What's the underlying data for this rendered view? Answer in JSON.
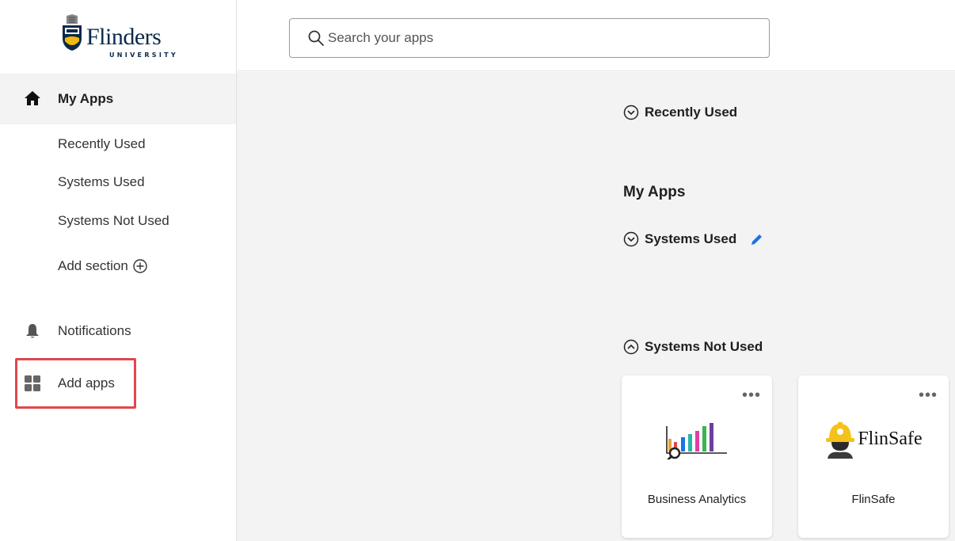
{
  "logo": {
    "wordmark": "Flinders",
    "subtitle": "UNIVERSITY"
  },
  "sidebar": {
    "home_label": "My Apps",
    "sub_items": [
      "Recently Used",
      "Systems Used",
      "Systems Not Used"
    ],
    "add_section_label": "Add section",
    "notifications_label": "Notifications",
    "add_apps_label": "Add apps"
  },
  "search": {
    "placeholder": "Search your apps",
    "value": ""
  },
  "main": {
    "recently_used": "Recently Used",
    "heading": "My Apps",
    "systems_used": "Systems Used",
    "systems_not_used": "Systems Not Used",
    "cards": [
      {
        "name": "Business Analytics",
        "icon": "bar-chart-magnifier-icon"
      },
      {
        "name": "FlinSafe",
        "icon": "hard-hat-worker-icon",
        "logo_text": "FlinSafe"
      }
    ]
  },
  "colors": {
    "accent_blue": "#1a73e8",
    "highlight_red": "#e0484c",
    "brand_navy": "#0b2a4a",
    "flinsafe_yellow": "#f5c21b"
  },
  "icons": {
    "home": "home-icon",
    "bell": "bell-icon",
    "grid": "grid-icon",
    "search": "search-icon",
    "chevron_down": "chevron-down-circle-icon",
    "chevron_up": "chevron-up-circle-icon",
    "edit": "pencil-icon",
    "add": "plus-circle-icon",
    "more": "more-icon"
  }
}
